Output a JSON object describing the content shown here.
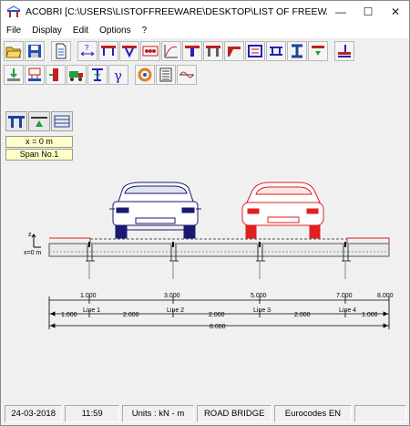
{
  "window": {
    "title": "ACOBRI [C:\\USERS\\LISTOFFREEWARE\\DESKTOP\\LIST OF FREEWARE.APM]"
  },
  "menu": [
    "File",
    "Display",
    "Edit",
    "Options",
    "?"
  ],
  "panel": {
    "position": "x = 0 m",
    "span": "Span No.1"
  },
  "drawing": {
    "vertical_label": "z",
    "origin_label": "x=0 m",
    "distance_labels": [
      "1.000",
      "3.000",
      "5.000",
      "7.000",
      "8.000"
    ],
    "line_labels": [
      "Line 1",
      "Line 2",
      "Line 3",
      "Line 4"
    ],
    "spacing_labels": [
      "1.000",
      "2.000",
      "2.000",
      "2.000",
      "1.000"
    ],
    "total_label": "8.000"
  },
  "status": {
    "date": "24-03-2018",
    "time": "11:59",
    "units": "Units : kN - m",
    "mode": "ROAD BRIDGE",
    "code": "Eurocodes EN"
  },
  "colors": {
    "left_car": "#1a1a70",
    "right_car": "#e02020",
    "accent": "#2020c0"
  }
}
